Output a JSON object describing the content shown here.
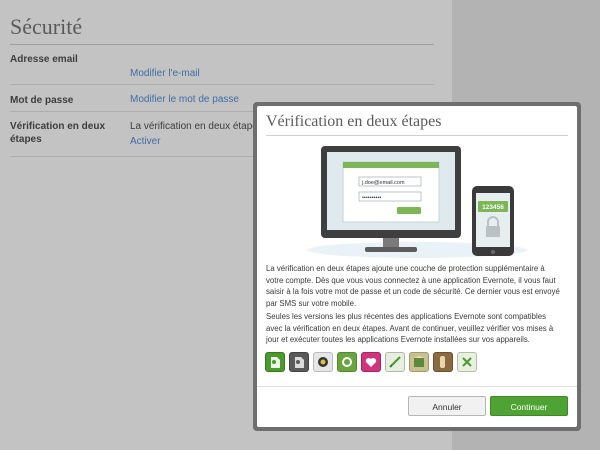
{
  "settings": {
    "title": "Sécurité",
    "rows": [
      {
        "label": "Adresse email",
        "link": "Modifier l'e-mail"
      },
      {
        "label": "Mot de passe",
        "link": "Modifier le mot de passe"
      },
      {
        "label": "Vérification en deux étapes",
        "text": "La vérification en deux étapes est a",
        "link": "Activer"
      }
    ]
  },
  "modal": {
    "title": "Vérification en deux étapes",
    "illustration": {
      "email_value": "j.doe@email.com",
      "password_value": "••••••••••",
      "phone_code": "123456"
    },
    "paragraph1": "La vérification en deux étapes ajoute une couche de protection supplémentaire à votre compte. Dès que vous vous connectez à une application Evernote, il vous faut saisir à la fois votre mot de passe et un code de sécurité. Ce dernier vous est envoyé par SMS sur votre mobile.",
    "paragraph2": "Seules les versions les plus récentes des applications Evernote sont compatibles avec la vérification en deux étapes. Avant de continuer, veuillez vérifier vos mises à jour et exécuter toutes les applications Evernote installées sur vos appareils.",
    "app_icons": [
      {
        "name": "evernote-app-icon",
        "color": "#4a9a2e"
      },
      {
        "name": "evernote-dark-app-icon",
        "color": "#5a5a5a"
      },
      {
        "name": "skitch-app-icon",
        "color": "#e6e6e6"
      },
      {
        "name": "evernote-food-app-icon",
        "color": "#6aa33f"
      },
      {
        "name": "evernote-hello-app-icon",
        "color": "#d0347a"
      },
      {
        "name": "penultimate-app-icon",
        "color": "#e8eee0"
      },
      {
        "name": "evernote-peek-app-icon",
        "color": "#c8c090"
      },
      {
        "name": "evernote-clearly-app-icon",
        "color": "#8a6a3e"
      },
      {
        "name": "web-clipper-app-icon",
        "color": "#e8f0e0"
      }
    ],
    "buttons": {
      "cancel": "Annuler",
      "continue": "Continuer"
    }
  },
  "colors": {
    "accent_green": "#4fa334",
    "link_blue": "#3f6ea6"
  }
}
